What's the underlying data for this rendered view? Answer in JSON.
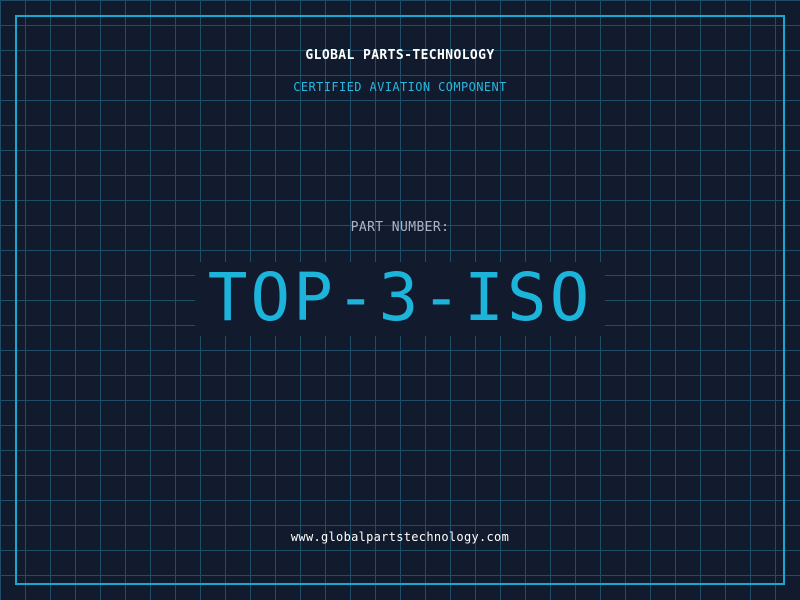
{
  "header": {
    "company": "GLOBAL PARTS-TECHNOLOGY",
    "tagline": "CERTIFIED AVIATION COMPONENT"
  },
  "part": {
    "label": "PART NUMBER:",
    "number": "TOP-3-ISO"
  },
  "footer": {
    "website": "www.globalpartstechnology.com"
  },
  "colors": {
    "background": "#121a2e",
    "grid": "#1f4f68",
    "accent": "#1aa7d0",
    "text": "#ffffff"
  }
}
